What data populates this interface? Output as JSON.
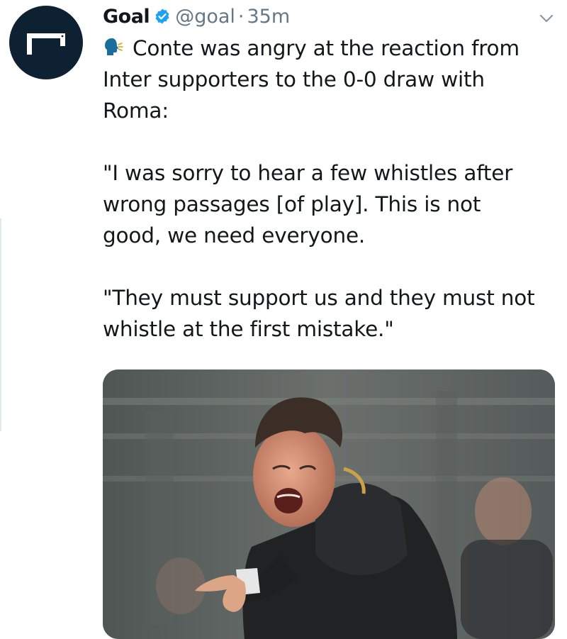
{
  "tweet": {
    "author_name": "Goal",
    "handle": "@goal",
    "separator": "·",
    "time": "35m",
    "text_lines": [
      "Conte was angry at the reaction from",
      "Inter supporters to the 0-0 draw with",
      "Roma:",
      "",
      "\"I was sorry to hear a few whistles after",
      "wrong passages [of play]. This is not",
      "good, we need everyone.",
      "",
      "\"They must support us and they must not",
      "whistle at the first mistake.\""
    ],
    "media_alt": "photo"
  },
  "colors": {
    "avatar_bg": "#0d2132",
    "verified_badge": "#1da1f2",
    "muted_text": "#657786",
    "emoji_blue": "#1b6e9b"
  },
  "icons": {
    "avatar": "goal-logo-icon",
    "verified": "verified-badge-icon",
    "speaking_head": "speaking-head-icon",
    "menu": "chevron-down-icon"
  }
}
